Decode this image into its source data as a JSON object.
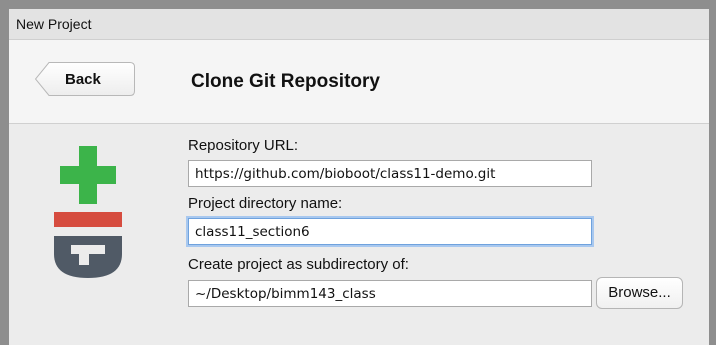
{
  "window": {
    "title": "New Project"
  },
  "header": {
    "back_label": "Back",
    "title": "Clone Git Repository"
  },
  "form": {
    "repo_url": {
      "label": "Repository URL:",
      "value": "https://github.com/bioboot/class11-demo.git"
    },
    "project_dir": {
      "label": "Project directory name:",
      "value": "class11_section6"
    },
    "subdirectory": {
      "label": "Create project as subdirectory of:",
      "value": "~/Desktop/bimm143_class"
    },
    "browse_label": "Browse..."
  },
  "colors": {
    "git_green": "#3cb44a",
    "git_red": "#d64c3f",
    "git_gray": "#505a66",
    "focus_ring": "#a8c8ef"
  },
  "icons": {
    "logo": "git-logo-icon"
  }
}
